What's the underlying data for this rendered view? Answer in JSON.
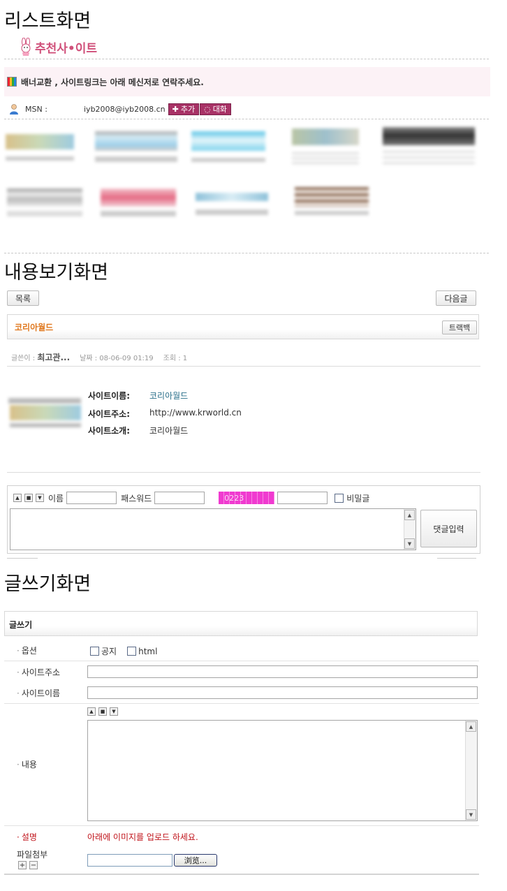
{
  "list_screen": {
    "title": "리스트화면",
    "logo_text": "추천사•이트",
    "notice_text": "배너교환 , 사이트링크는 아래 메신저로 연락주세요.",
    "msn_label": "MSN :",
    "msn_email": "iyb2008@iyb2008.cn",
    "add_button": "추가",
    "chat_button": "대화"
  },
  "view_screen": {
    "title": "내용보기화면",
    "list_button": "목록",
    "next_button": "다음글",
    "post_title": "코리아월드",
    "trackback_button": "트랙백",
    "author_label": "글쓴이 :",
    "author_name": "최고관...",
    "date_label": "날짜 : 08-06-09 01:19",
    "views_label": "조회 : 1",
    "site_name_key": "사이트이름:",
    "site_name_value": "코리아월드",
    "site_url_key": "사이트주소:",
    "site_url_value": "http://www.krworld.cn",
    "site_intro_key": "사이트소개:",
    "site_intro_value": "코리아월드",
    "comment": {
      "name_label": "이름",
      "password_label": "패스워드",
      "captcha_text": "0223",
      "secret_label": "비밀글",
      "submit_button": "댓글입력"
    }
  },
  "write_screen": {
    "title": "글쓰기화면",
    "header": "글쓰기",
    "options_label": "옵션",
    "notice_checkbox": "공지",
    "html_checkbox": "html",
    "site_url_label": "사이트주소",
    "site_name_label": "사이트이름",
    "content_label": "내용",
    "desc_label": "설명",
    "desc_text": "아래에 이미지를 업로드 하세요.",
    "file_label": "파일첨부",
    "browse_button": "浏览..."
  },
  "colors": {
    "brand_pink": "#d0507a",
    "button_maroon": "#a83266",
    "title_orange": "#e0781e",
    "link_teal": "#2a6f8a",
    "desc_red": "#c0141b",
    "captcha_magenta": "#f03ad0"
  }
}
